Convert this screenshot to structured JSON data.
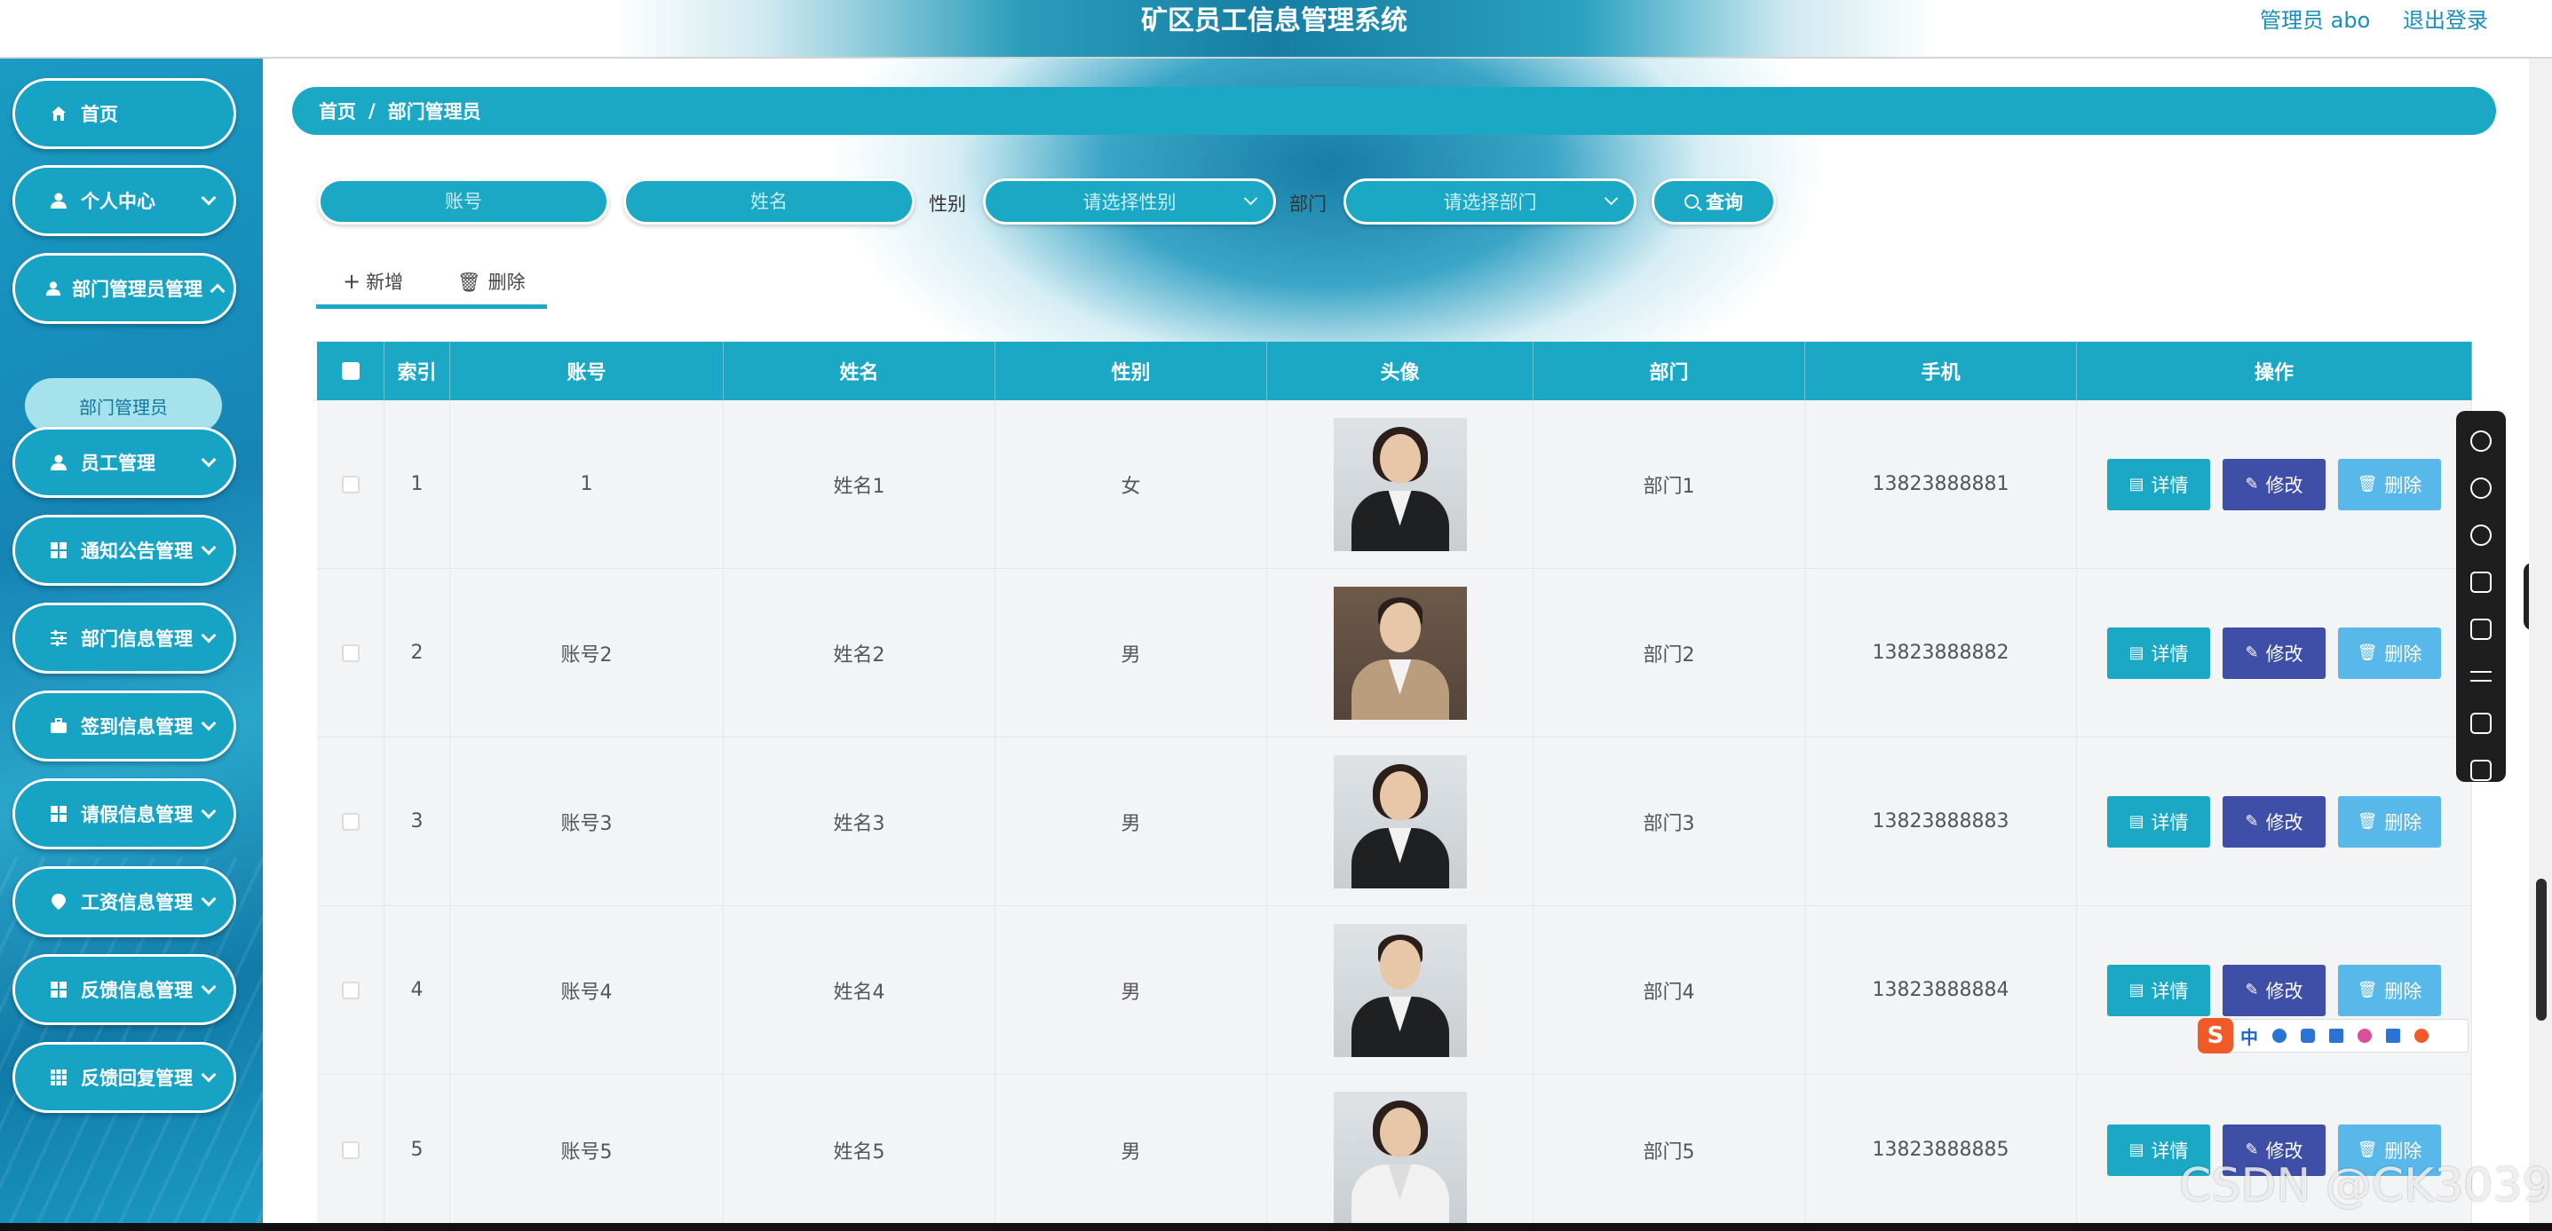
{
  "header": {
    "title": "矿区员工信息管理系统",
    "user": "管理员 abo",
    "logout": "退出登录"
  },
  "sidebar": {
    "items": [
      {
        "label": "首页",
        "icon": "home-icon"
      },
      {
        "label": "个人中心",
        "icon": "user-icon"
      },
      {
        "label": "部门管理员管理",
        "icon": "user-icon"
      },
      {
        "label": "员工管理",
        "icon": "user-icon"
      },
      {
        "label": "通知公告管理",
        "icon": "grid-icon"
      },
      {
        "label": "部门信息管理",
        "icon": "sliders-icon"
      },
      {
        "label": "签到信息管理",
        "icon": "briefcase-icon"
      },
      {
        "label": "请假信息管理",
        "icon": "grid-icon"
      },
      {
        "label": "工资信息管理",
        "icon": "location-icon"
      },
      {
        "label": "反馈信息管理",
        "icon": "grid-icon"
      },
      {
        "label": "反馈回复管理",
        "icon": "table-icon"
      }
    ],
    "sub_item": "部门管理员"
  },
  "breadcrumb": {
    "home": "首页",
    "separator": "/",
    "current": "部门管理员"
  },
  "search": {
    "account_placeholder": "账号",
    "name_placeholder": "姓名",
    "gender_label": "性别",
    "gender_placeholder": "请选择性别",
    "dept_label": "部门",
    "dept_placeholder": "请选择部门",
    "query_button": "查询"
  },
  "actions": {
    "add": "新增",
    "delete": "删除"
  },
  "table": {
    "columns": [
      "索引",
      "账号",
      "姓名",
      "性别",
      "头像",
      "部门",
      "手机",
      "操作"
    ],
    "rows": [
      {
        "index": "1",
        "account": "1",
        "name": "姓名1",
        "gender": "女",
        "dept": "部门1",
        "phone": "13823888881"
      },
      {
        "index": "2",
        "account": "账号2",
        "name": "姓名2",
        "gender": "男",
        "dept": "部门2",
        "phone": "13823888882"
      },
      {
        "index": "3",
        "account": "账号3",
        "name": "姓名3",
        "gender": "男",
        "dept": "部门3",
        "phone": "13823888883"
      },
      {
        "index": "4",
        "account": "账号4",
        "name": "姓名4",
        "gender": "男",
        "dept": "部门4",
        "phone": "13823888884"
      },
      {
        "index": "5",
        "account": "账号5",
        "name": "姓名5",
        "gender": "男",
        "dept": "部门5",
        "phone": "13823888885"
      }
    ],
    "row_buttons": {
      "detail": "详情",
      "edit": "修改",
      "delete": "删除"
    }
  },
  "ime": {
    "cn": "中"
  },
  "watermark": "CSDN @CK3039",
  "colors": {
    "primary": "#1aa8c4",
    "edit": "#3f4fa8",
    "delete": "#58b8ea",
    "sidebar": "#1685b6"
  }
}
